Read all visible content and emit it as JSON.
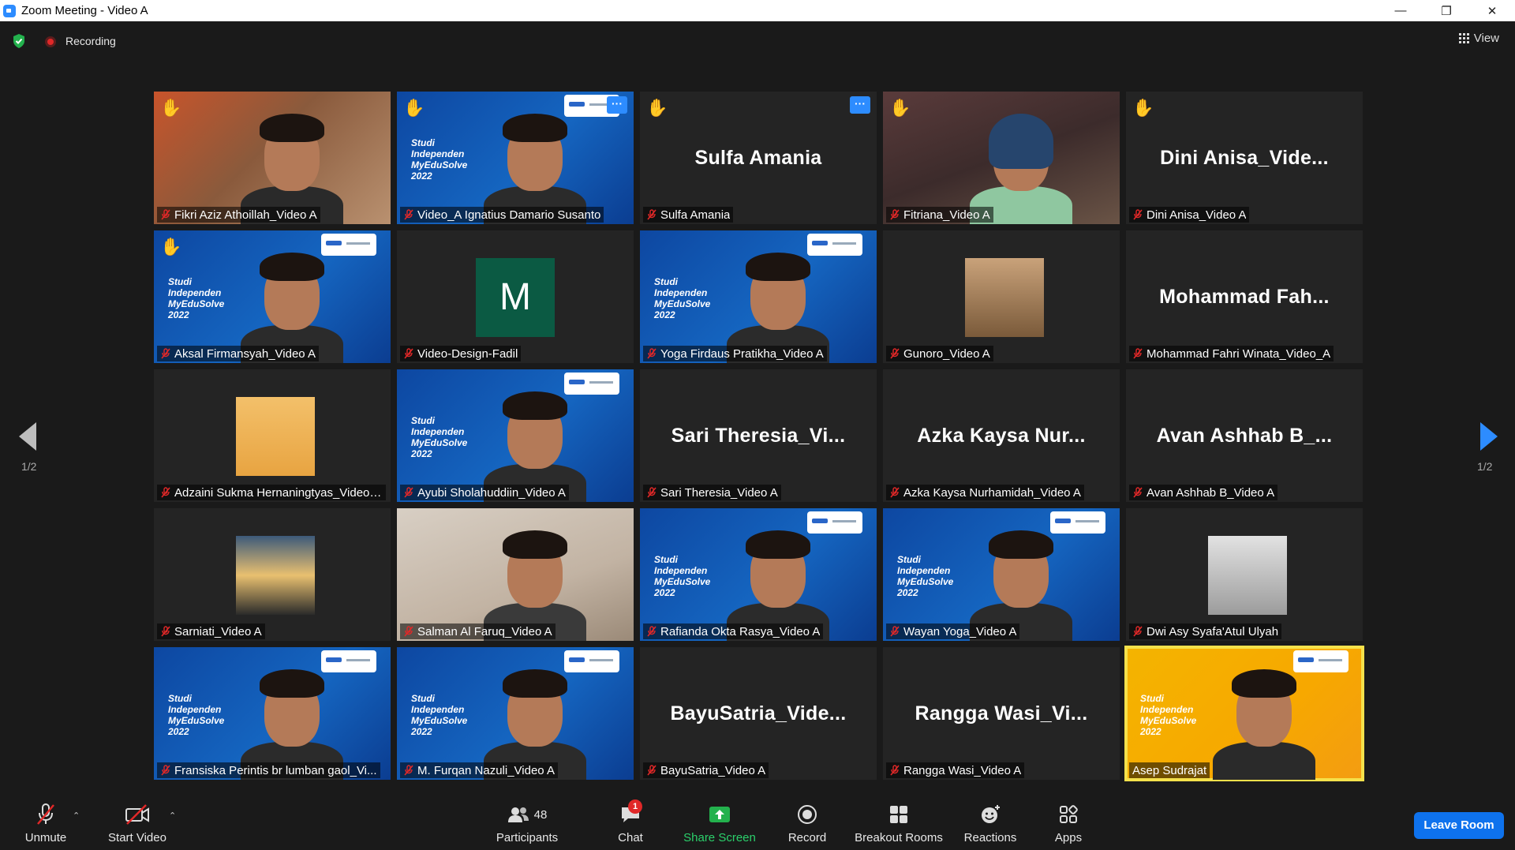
{
  "window": {
    "title": "Zoom Meeting - Video A",
    "minimize_icon": "minimize-icon",
    "restore_icon": "restore-icon",
    "close_icon": "close-icon"
  },
  "topbar": {
    "recording_label": "Recording",
    "view_label": "View"
  },
  "pagination": {
    "left": "1/2",
    "right": "1/2"
  },
  "participants_tiles": [
    {
      "display": "Fikri Aziz Athoillah_Video A",
      "big_name": "",
      "hand": true,
      "bg": "warm",
      "video": true
    },
    {
      "display": "Video_A Ignatius Damario Susanto",
      "big_name": "",
      "hand": true,
      "bg": "blue",
      "video": true,
      "studi": true
    },
    {
      "display": "Sulfa Amania",
      "big_name": "Sulfa Amania",
      "hand": true,
      "bg": "none",
      "video": false
    },
    {
      "display": "Fitriana_Video A",
      "big_name": "",
      "hand": true,
      "bg": "dark",
      "video": true
    },
    {
      "display": "Dini Anisa_Video A",
      "big_name": "Dini  Anisa_Vide...",
      "hand": true,
      "bg": "none",
      "video": false
    },
    {
      "display": "Aksal Firmansyah_Video A",
      "big_name": "",
      "hand": true,
      "bg": "blue",
      "video": true,
      "studi": true
    },
    {
      "display": "Video-Design-Fadil",
      "big_name": "",
      "hand": false,
      "bg": "none",
      "video": false,
      "avatar_letter": "M"
    },
    {
      "display": "Yoga Firdaus Pratikha_Video A",
      "big_name": "",
      "hand": false,
      "bg": "blue",
      "video": true,
      "studi": true
    },
    {
      "display": "Gunoro_Video A",
      "big_name": "",
      "hand": false,
      "bg": "none",
      "video": false
    },
    {
      "display": "Mohammad Fahri Winata_Video_A",
      "big_name": "Mohammad  Fah...",
      "hand": false,
      "bg": "none",
      "video": false
    },
    {
      "display": "Adzaini Sukma Hernaningtyas_Video ...",
      "big_name": "",
      "hand": false,
      "bg": "none",
      "video": false
    },
    {
      "display": "Ayubi Sholahuddiin_Video A",
      "big_name": "",
      "hand": false,
      "bg": "blue",
      "video": true,
      "studi": true
    },
    {
      "display": "Sari Theresia_Video A",
      "big_name": "Sari  Theresia_Vi...",
      "hand": false,
      "bg": "none",
      "video": false
    },
    {
      "display": "Azka Kaysa Nurhamidah_Video A",
      "big_name": "Azka  Kaysa  Nur...",
      "hand": false,
      "bg": "none",
      "video": false
    },
    {
      "display": "Avan Ashhab B_Video A",
      "big_name": "Avan  Ashhab  B_...",
      "hand": false,
      "bg": "none",
      "video": false
    },
    {
      "display": "Sarniati_Video A",
      "big_name": "",
      "hand": false,
      "bg": "none",
      "video": false
    },
    {
      "display": "Salman Al Faruq_Video A",
      "big_name": "",
      "hand": false,
      "bg": "room",
      "video": true
    },
    {
      "display": "Rafianda Okta Rasya_Video A",
      "big_name": "",
      "hand": false,
      "bg": "blue",
      "video": true,
      "studi": true
    },
    {
      "display": "Wayan Yoga_Video A",
      "big_name": "",
      "hand": false,
      "bg": "blue",
      "video": true,
      "studi": true
    },
    {
      "display": "Dwi Asy Syafa'Atul Ulyah",
      "big_name": "",
      "hand": false,
      "bg": "none",
      "video": false
    },
    {
      "display": "Fransiska Perintis br lumban gaol_Vi...",
      "big_name": "",
      "hand": false,
      "bg": "blue",
      "video": true,
      "studi": true
    },
    {
      "display": "M. Furqan Nazuli_Video A",
      "big_name": "",
      "hand": false,
      "bg": "blue",
      "video": true,
      "studi": true
    },
    {
      "display": "BayuSatria_Video A",
      "big_name": "BayuSatria_Vide...",
      "hand": false,
      "bg": "none",
      "video": false
    },
    {
      "display": "Rangga Wasi_Video A",
      "big_name": "Rangga  Wasi_Vi...",
      "hand": false,
      "bg": "none",
      "video": false
    },
    {
      "display": "Asep Sudrajat",
      "big_name": "",
      "hand": false,
      "bg": "orange",
      "video": true,
      "studi": true,
      "active": true
    }
  ],
  "studi_text": [
    "Studi",
    "Independen",
    "MyEduSolve",
    "2022"
  ],
  "toolbar": {
    "unmute": "Unmute",
    "start_video": "Start Video",
    "participants": "Participants",
    "participants_count": "48",
    "chat": "Chat",
    "chat_badge": "1",
    "share_screen": "Share Screen",
    "record": "Record",
    "breakout_rooms": "Breakout Rooms",
    "reactions": "Reactions",
    "apps": "Apps",
    "leave": "Leave Room"
  },
  "colors": {
    "accent_blue": "#2d8cff",
    "share_green": "#2bd06b",
    "record_red": "#e02828",
    "active_speaker": "#f5e14b",
    "hand_yellow": "#f5c243"
  }
}
